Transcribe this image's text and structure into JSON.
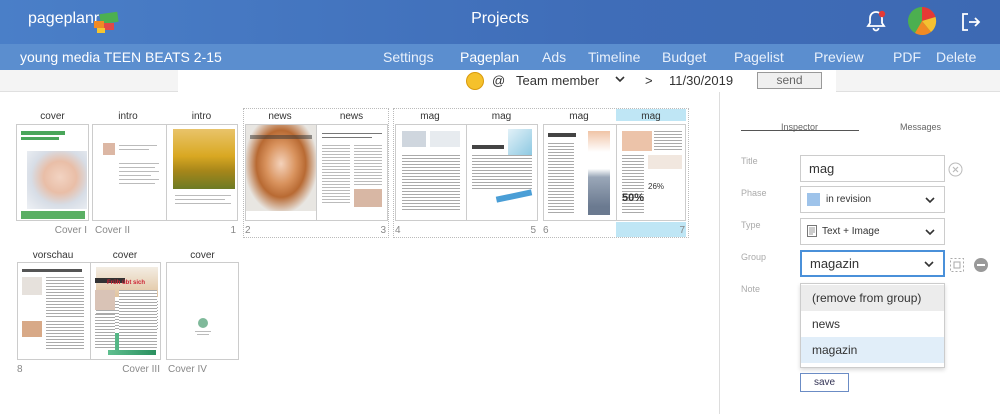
{
  "header": {
    "logo": "pageplanr",
    "title": "Projects",
    "icons": [
      "bell-icon",
      "progress-pie-icon",
      "logout-icon"
    ]
  },
  "nav": {
    "project_name": "young media TEEN BEATS 2-15",
    "items": [
      "Settings",
      "Pageplan",
      "Ads",
      "Timeline",
      "Budget",
      "Pagelist",
      "Preview",
      "PDF",
      "Delete"
    ]
  },
  "filter": {
    "at": "@",
    "member": "Team member",
    "gt": ">",
    "date": "11/30/2019",
    "send": "send"
  },
  "pages": {
    "titles": [
      "cover",
      "intro",
      "intro",
      "news",
      "news",
      "mag",
      "mag",
      "mag",
      "mag",
      "vorschau",
      "cover",
      "cover"
    ],
    "numbers": [
      "Cover I",
      "Cover II",
      "1",
      "2",
      "3",
      "4",
      "5",
      "6",
      "7",
      "8",
      "Cover III",
      "Cover IV"
    ],
    "cover_headline": "Zahnarztpraxis Dr. Winter & Partner",
    "news_headline": "Auf die sanfte Tour",
    "mag_headline": "Mein Mund ist...",
    "cover3_headline": "Früh übt sich",
    "percent_1": "26%",
    "percent_2": "50%"
  },
  "inspector": {
    "tabs": [
      "Inspector",
      "Messages"
    ],
    "labels": {
      "title": "Title",
      "phase": "Phase",
      "type": "Type",
      "group": "Group",
      "note": "Note"
    },
    "title_value": "mag",
    "phase_value": "in revision",
    "type_value": "Text + Image",
    "group_value": "magazin",
    "dropdown": [
      "(remove from group)",
      "news",
      "magazin"
    ],
    "save": "save",
    "colors": {
      "accent": "#4a90d9",
      "phase_swatch": "#9ec3ea",
      "highlight": "#bfe6f5"
    }
  }
}
